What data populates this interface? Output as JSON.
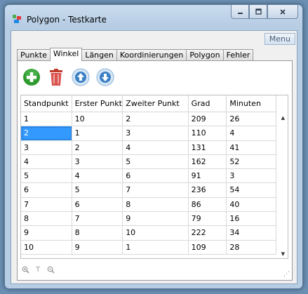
{
  "window": {
    "title": "Polygon - Testkarte",
    "menu_label": "Menu"
  },
  "tabs": [
    {
      "label": "Punkte",
      "active": false
    },
    {
      "label": "Winkel",
      "active": true
    },
    {
      "label": "Längen",
      "active": false
    },
    {
      "label": "Koordinierungen",
      "active": false
    },
    {
      "label": "Polygon",
      "active": false
    },
    {
      "label": "Fehler",
      "active": false
    }
  ],
  "toolbar": {
    "icons": [
      "add-icon",
      "delete-icon",
      "move-up-icon",
      "move-down-icon"
    ],
    "colors": {
      "add": "#2e9a2e",
      "delete": "#c0392b",
      "arrows": "#3b7fc4"
    }
  },
  "table": {
    "columns": [
      "Standpunkt",
      "Erster Punkt",
      "Zweiter Punkt",
      "Grad",
      "Minuten"
    ],
    "rows": [
      [
        "1",
        "10",
        "2",
        "209",
        "26"
      ],
      [
        "2",
        "1",
        "3",
        "110",
        "4"
      ],
      [
        "3",
        "2",
        "4",
        "131",
        "41"
      ],
      [
        "4",
        "3",
        "5",
        "162",
        "52"
      ],
      [
        "5",
        "4",
        "6",
        "91",
        "3"
      ],
      [
        "6",
        "5",
        "7",
        "236",
        "54"
      ],
      [
        "7",
        "6",
        "8",
        "86",
        "40"
      ],
      [
        "8",
        "7",
        "9",
        "79",
        "16"
      ],
      [
        "9",
        "8",
        "10",
        "222",
        "34"
      ],
      [
        "10",
        "9",
        "1",
        "109",
        "28"
      ]
    ],
    "selected_row": 1,
    "selected_col": 0,
    "selection_color": "#3399ff"
  },
  "statusbar": {
    "icons": [
      "zoom-in-icon",
      "text-icon",
      "zoom-out-icon"
    ],
    "text_glyph": "T"
  }
}
